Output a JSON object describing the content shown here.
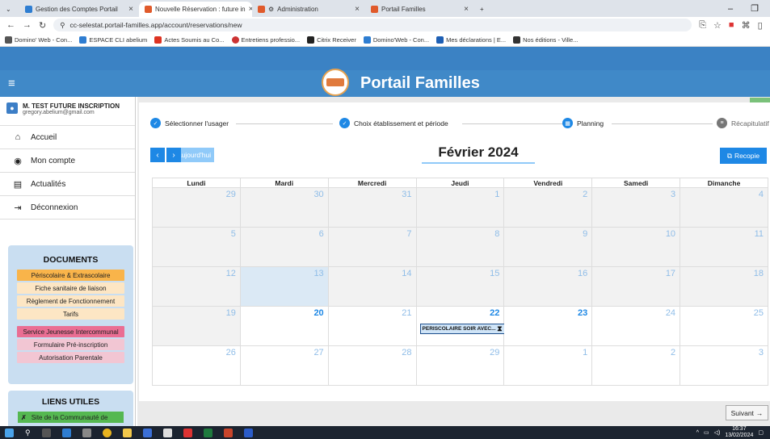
{
  "browser": {
    "tabs": [
      {
        "title": "Gestion des Comptes Portail",
        "color": "#2e7dd1"
      },
      {
        "title": "Nouvelle Réservation : future in",
        "color": "#e05a2b"
      },
      {
        "title": "Administration",
        "color": "#e05a2b"
      },
      {
        "title": "Portail Familles",
        "color": "#e05a2b"
      }
    ],
    "url": "cc-selestat.portail-familles.app/account/reservations/new",
    "bookmarks": [
      "Domino' Web - Con...",
      "ESPACE CLI abelium",
      "Actes Soumis au Co...",
      "Entretiens professio...",
      "Citrix Receiver",
      "Domino'Web - Con...",
      "Mes déclarations | E...",
      "Nos éditions - Ville..."
    ]
  },
  "app": {
    "title": "Portail Familles",
    "brand_color": "#4089c8"
  },
  "user": {
    "name": "M. TEST FUTURE INSCRIPTION",
    "email": "gregory.abelium@gmail.com"
  },
  "nav": [
    {
      "label": "Accueil",
      "icon": "home-icon"
    },
    {
      "label": "Mon compte",
      "icon": "account-icon"
    },
    {
      "label": "Actualités",
      "icon": "news-icon"
    },
    {
      "label": "Déconnexion",
      "icon": "logout-icon"
    }
  ],
  "documents": {
    "title": "DOCUMENTS",
    "items": [
      {
        "label": "Périscolaire & Extrascolaire",
        "color": "#f9b44a"
      },
      {
        "label": "Fiche sanitaire de liaison",
        "color": "#fde6c4"
      },
      {
        "label": "Règlement de Fonctionnement",
        "color": "#fde6c4"
      },
      {
        "label": "Tarifs",
        "color": "#fde6c4"
      },
      {
        "label": "Service Jeunesse Intercommunal",
        "color": "#ea6e93"
      },
      {
        "label": "Formulaire Pré-inscription",
        "color": "#f2c6d3"
      },
      {
        "label": "Autorisation Parentale",
        "color": "#f2c6d3"
      }
    ]
  },
  "links": {
    "title": "LIENS UTILES",
    "items": [
      {
        "label": "Site de la Communauté de"
      }
    ]
  },
  "stepper": [
    {
      "label": "Sélectionner l'usager",
      "state": "done"
    },
    {
      "label": "Choix établissement et période",
      "state": "done"
    },
    {
      "label": "Planning",
      "state": "current"
    },
    {
      "label": "Récapitulatif",
      "state": "todo"
    }
  ],
  "calendar": {
    "today_label": "Aujourd'hui",
    "month": "Février 2024",
    "copy_label": "Recopie",
    "weekdays": [
      "Lundi",
      "Mardi",
      "Mercredi",
      "Jeudi",
      "Vendredi",
      "Samedi",
      "Dimanche"
    ],
    "weeks": [
      [
        "29",
        "30",
        "31",
        "1",
        "2",
        "3",
        "4"
      ],
      [
        "5",
        "6",
        "7",
        "8",
        "9",
        "10",
        "11"
      ],
      [
        "12",
        "13",
        "14",
        "15",
        "16",
        "17",
        "18"
      ],
      [
        "19",
        "20",
        "21",
        "22",
        "23",
        "24",
        "25"
      ],
      [
        "26",
        "27",
        "28",
        "29",
        "1",
        "2",
        "3"
      ]
    ],
    "event": {
      "label": "PERISCOLAIRE SOIR AVEC...",
      "icon": "hourglass-icon"
    }
  },
  "next_label": "Suivant",
  "taskbar": {
    "time": "16:37",
    "date": "13/02/2024"
  }
}
